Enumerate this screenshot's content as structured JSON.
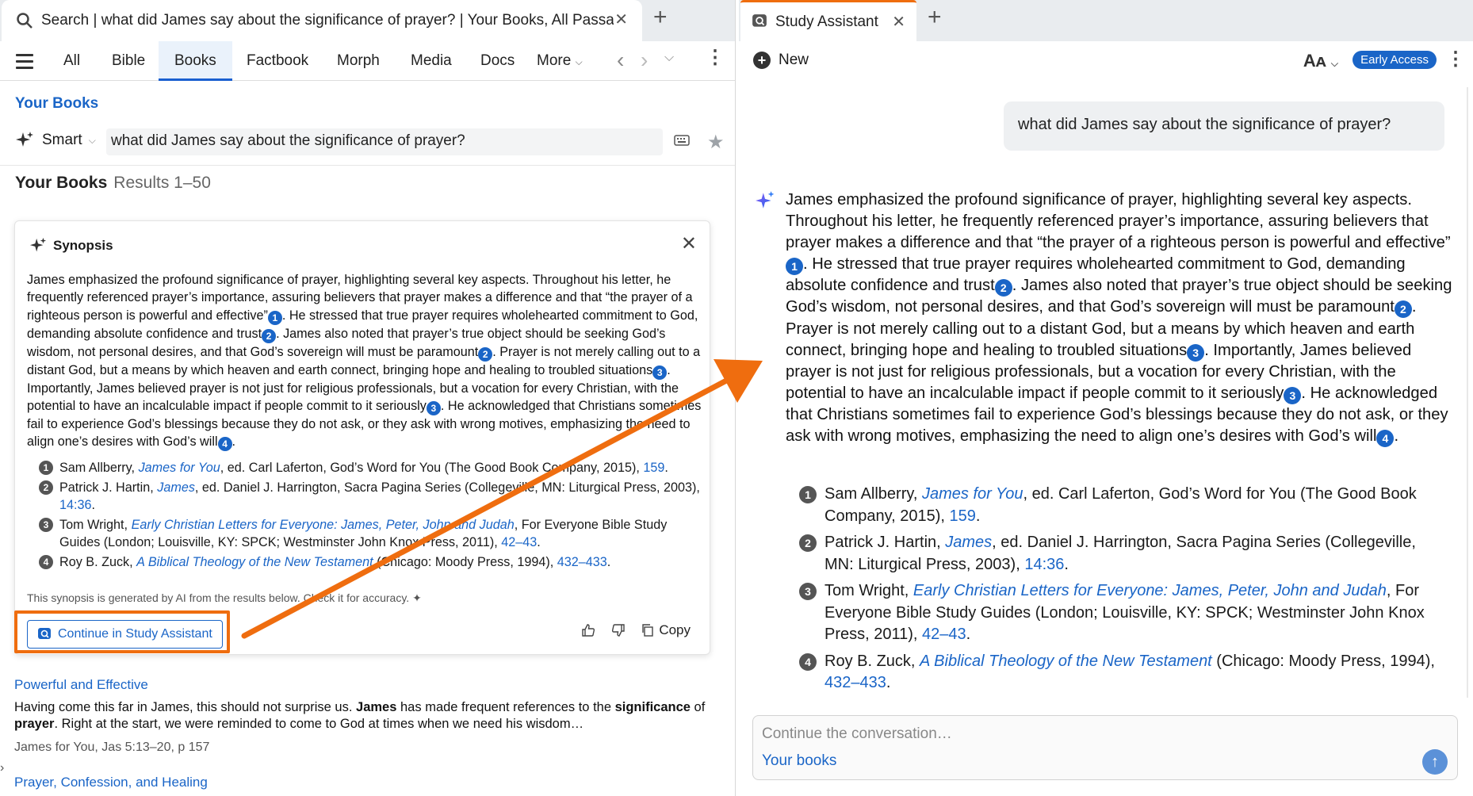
{
  "left": {
    "tab_title": "Search | what did James say about the significance of prayer? | Your Books, All Passages",
    "nav": [
      "All",
      "Bible",
      "Books",
      "Factbook",
      "Morph",
      "Media",
      "Docs",
      "More"
    ],
    "section_link": "Your Books",
    "smart_label": "Smart",
    "search_value": "what did James say about the significance of prayer?",
    "results_title": "Your Books",
    "results_range": "Results 1–50",
    "synopsis": {
      "title": "Synopsis",
      "body_parts": [
        "James emphasized the profound significance of prayer, highlighting several key aspects. Throughout his letter, he frequently referenced prayer’s importance, assuring believers that prayer makes a difference and that “the prayer of a righteous person is powerful and effective”",
        "1",
        ". He stressed that true prayer requires wholehearted commitment to God, demanding absolute confidence and trust",
        "2",
        ". James also noted that prayer’s true object should be seeking God’s wisdom, not personal desires, and that God’s sovereign will must be paramount",
        "2",
        ". Prayer is not merely calling out to a distant God, but a means by which heaven and earth connect, bringing hope and healing to troubled situations",
        "3",
        ". Importantly, James believed prayer is not just for religious professionals, but a vocation for every Christian, with the potential to have an incalculable impact if people commit to it seriously",
        "3",
        ". He acknowledged that Christians sometimes fail to experience God’s blessings because they do not ask, or they ask with wrong motives, emphasizing the need to align one’s desires with God’s will",
        "4",
        "."
      ],
      "refs": [
        {
          "num": "1",
          "pre": "Sam Allberry, ",
          "title": "James for You",
          "post": ", ed. Carl Laferton, God’s Word for You (The Good Book Company, 2015), ",
          "page": "159",
          "end": "."
        },
        {
          "num": "2",
          "pre": "Patrick J. Hartin, ",
          "title": "James",
          "post": ", ed. Daniel J. Harrington, Sacra Pagina Series (Collegeville, MN: Liturgical Press, 2003), ",
          "page": "14:36",
          "end": "."
        },
        {
          "num": "3",
          "pre": "Tom Wright, ",
          "title": "Early Christian Letters for Everyone: James, Peter, John and Judah",
          "post": ", For Everyone Bible Study Guides (London; Louisville, KY: SPCK; Westminster John Knox Press, 2011), ",
          "page": "42–43",
          "end": "."
        },
        {
          "num": "4",
          "pre": "Roy B. Zuck, ",
          "title": "A Biblical Theology of the New Testament",
          "post": " (Chicago: Moody Press, 1994), ",
          "page": "432–433",
          "end": "."
        }
      ],
      "ai_note": "This synopsis is generated by AI from the results below. Check it for accuracy.",
      "continue_label": "Continue in Study Assistant",
      "copy_label": "Copy"
    },
    "results": [
      {
        "title": "Powerful and Effective",
        "text_parts": [
          "Having come this far in James, this should not surprise us. ",
          "James",
          " has made frequent references to the ",
          "significance",
          " of ",
          "prayer",
          ". Right at the start, we were reminded to come to God at times when we need his wisdom…"
        ],
        "source": "James for You, Jas 5:13–20, p 157"
      },
      {
        "title": "Prayer, Confession, and Healing"
      }
    ]
  },
  "right": {
    "tab_title": "Study Assistant",
    "new_label": "New",
    "aa_label": "Aᴀ",
    "early_access": "Early Access",
    "question": "what did James say about the significance of prayer?",
    "composer_placeholder": "Continue the conversation…",
    "composer_scope": "Your books"
  },
  "colors": {
    "accent": "#1a65c7",
    "highlight_orange": "#ef6d0f"
  }
}
